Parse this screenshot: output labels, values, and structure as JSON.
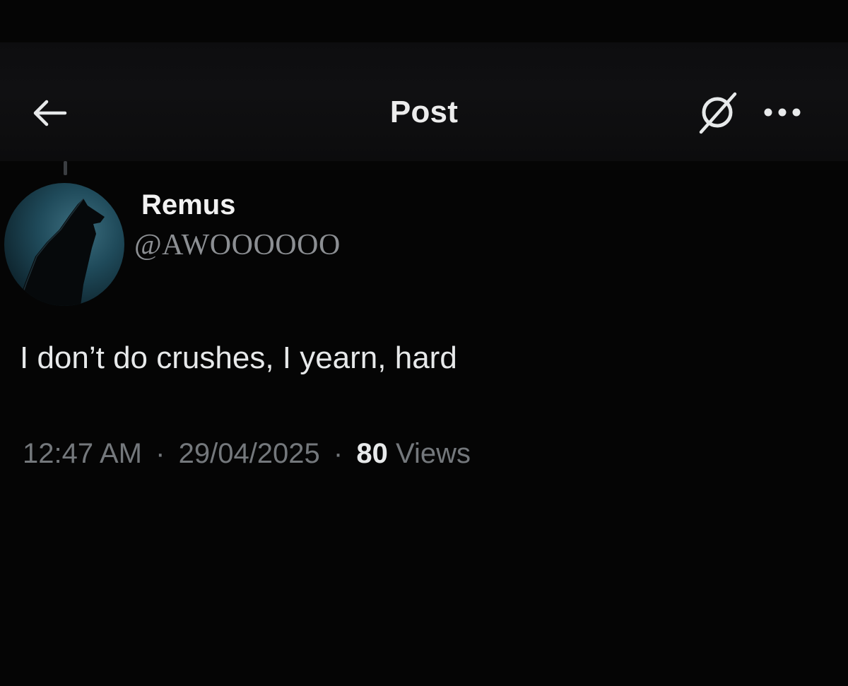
{
  "header": {
    "title": "Post",
    "back_icon": "arrow-left-icon",
    "grok_icon": "grok-slash-circle-icon",
    "more_icon": "ellipsis-icon"
  },
  "post": {
    "author": {
      "display_name": "Remus",
      "handle": "@AWOOOOOO",
      "avatar": "howling-wolf-avatar"
    },
    "text": "I don’t do crushes, I yearn, hard",
    "time": "12:47 AM",
    "date": "29/04/2025",
    "separator": "·",
    "views_count": "80",
    "views_label": "Views"
  },
  "colors": {
    "background": "#050505",
    "header_background": "#0f0f11",
    "primary_text": "#e7e9ea",
    "secondary_text": "#74787c",
    "handle_text": "#8c8f93",
    "avatar_glow": "#2c5a6a"
  }
}
